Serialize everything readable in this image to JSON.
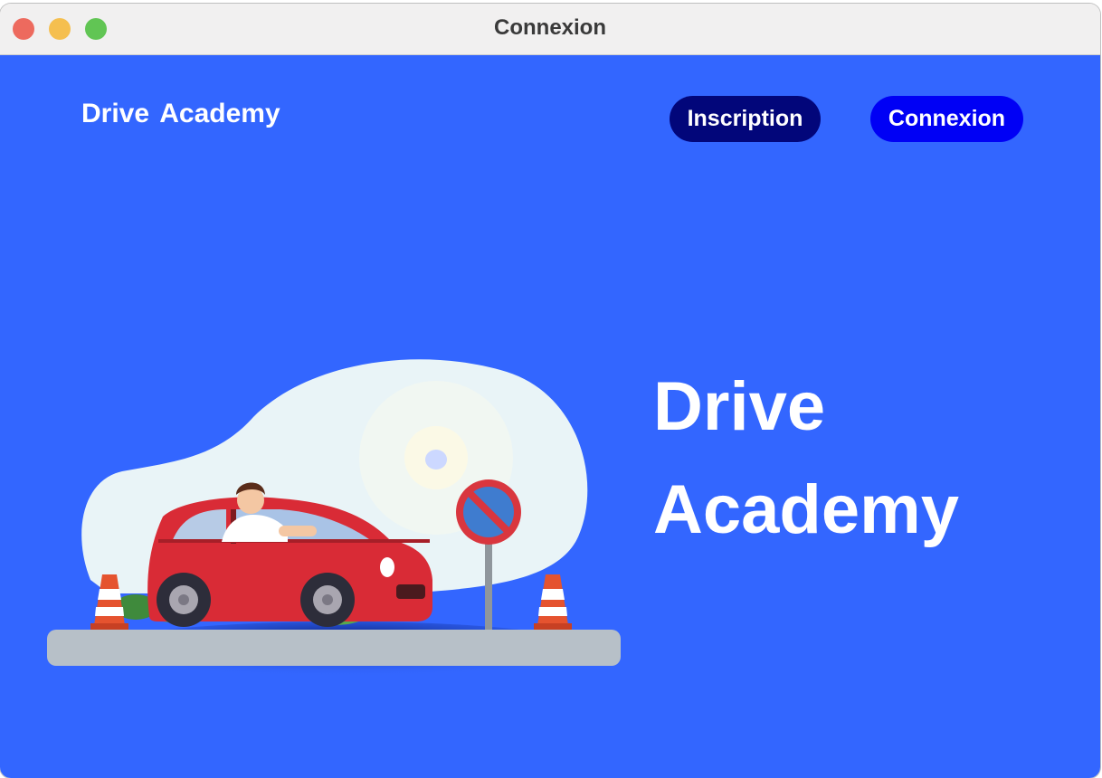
{
  "window": {
    "title": "Connexion"
  },
  "header": {
    "brand": "Drive Academy",
    "inscription_label": "Inscription",
    "connexion_label": "Connexion"
  },
  "hero": {
    "title_line1": "Drive",
    "title_line2": "Academy"
  },
  "illustration": {
    "icon": "car-driving-school-illustration"
  },
  "colors": {
    "background": "#3366ff",
    "inscription_button": "#02067a",
    "connexion_button": "#0000f5",
    "traffic_close": "#ed6a5e",
    "traffic_minimize": "#f5bf4f",
    "traffic_zoom": "#61c554",
    "car": "#d92b36",
    "road": "#b7c0c8",
    "blob": "#e9f4f7"
  }
}
